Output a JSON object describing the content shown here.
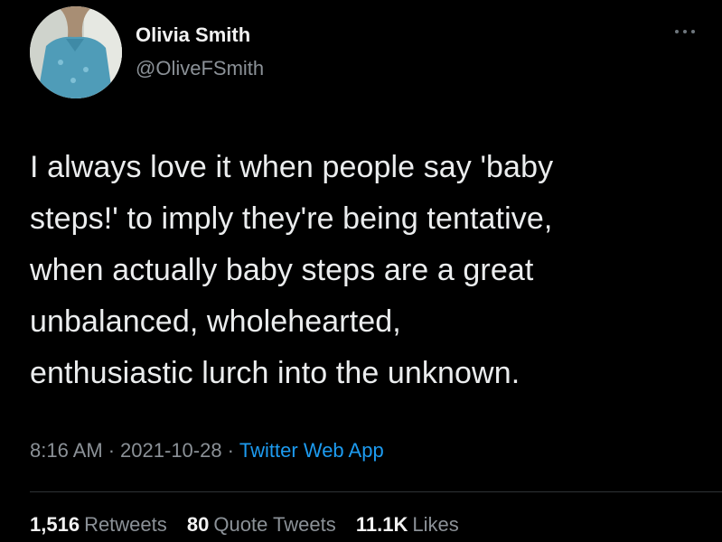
{
  "colors": {
    "background": "#000000",
    "text_primary": "#e7e9ea",
    "text_secondary": "#8b9197",
    "link": "#1d9bf0",
    "divider": "#2f3336"
  },
  "author": {
    "name": "Olivia Smith",
    "handle": "@OliveFSmith",
    "avatar_icon": "profile-photo-avatar"
  },
  "more_icon": "more-options-icon",
  "tweet": {
    "lines": [
      "I always love it when people say 'baby",
      "steps!' to imply they're being tentative,",
      "when actually baby steps are a great",
      "unbalanced, wholehearted,",
      "enthusiastic lurch into the unknown."
    ]
  },
  "meta": {
    "time": "8:16 AM",
    "separator": "·",
    "date": "2021-10-28",
    "source": "Twitter Web App"
  },
  "stats": {
    "retweets_count": "1,516",
    "retweets_label": "Retweets",
    "quotes_count": "80",
    "quotes_label": "Quote Tweets",
    "likes_count": "11.1K",
    "likes_label": "Likes"
  }
}
